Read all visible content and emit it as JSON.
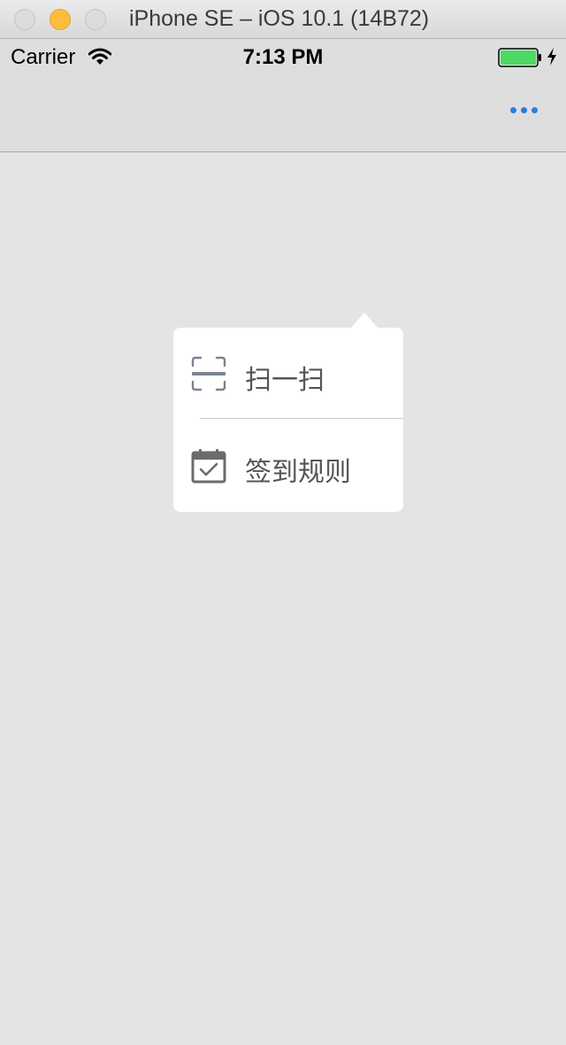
{
  "window": {
    "title": "iPhone SE – iOS 10.1 (14B72)"
  },
  "status_bar": {
    "carrier": "Carrier",
    "time": "7:13 PM",
    "icons": [
      "wifi-icon",
      "battery-icon",
      "charging-bolt-icon"
    ]
  },
  "nav_bar": {
    "more_icon": "more-dots-icon",
    "accent_color": "#2a7ce0"
  },
  "popover_menu": {
    "items": [
      {
        "label": "扫一扫",
        "icon": "scan-icon"
      },
      {
        "label": "签到规则",
        "icon": "calendar-check-icon"
      }
    ]
  },
  "colors": {
    "background": "#e4e4e4",
    "battery_fill": "#4cd964",
    "menu_text": "#555555",
    "icon_color": "#6b7280"
  }
}
